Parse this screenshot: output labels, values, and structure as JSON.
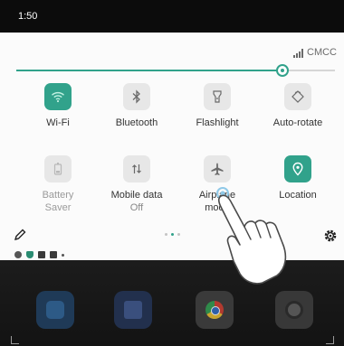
{
  "status_bar": {
    "time": "1:50"
  },
  "quick_settings": {
    "carrier": "CMCC",
    "brightness": {
      "level": 0.84
    },
    "tiles": [
      {
        "label": "Wi-Fi",
        "icon": "wifi-icon",
        "state": "on"
      },
      {
        "label": "Bluetooth",
        "icon": "bluetooth-icon",
        "state": "inactive"
      },
      {
        "label": "Flashlight",
        "icon": "flashlight-icon",
        "state": "inactive"
      },
      {
        "label": "Auto-rotate",
        "icon": "auto-rotate-icon",
        "state": "inactive"
      },
      {
        "label": "Battery Saver",
        "icon": "battery-icon",
        "state": "disabled"
      },
      {
        "label": "Mobile data",
        "sublabel": "Off",
        "icon": "mobile-data-icon",
        "state": "inactive"
      },
      {
        "label": "Airplane mode",
        "icon": "airplane-icon",
        "state": "inactive"
      },
      {
        "label": "Location",
        "icon": "location-icon",
        "state": "on"
      }
    ],
    "page_indicator": {
      "count": 3,
      "active": 1
    }
  },
  "dock": [
    {
      "icon": "phone-app-icon"
    },
    {
      "icon": "messages-app-icon"
    },
    {
      "icon": "chrome-app-icon"
    },
    {
      "icon": "camera-app-icon"
    }
  ],
  "colors": {
    "accent": "#31a28b",
    "status_bar": "#0c0c0c",
    "panel": "#fbfbfb",
    "tile_inactive": "#e7e7e7",
    "home_dim": "#1c1c1c"
  }
}
